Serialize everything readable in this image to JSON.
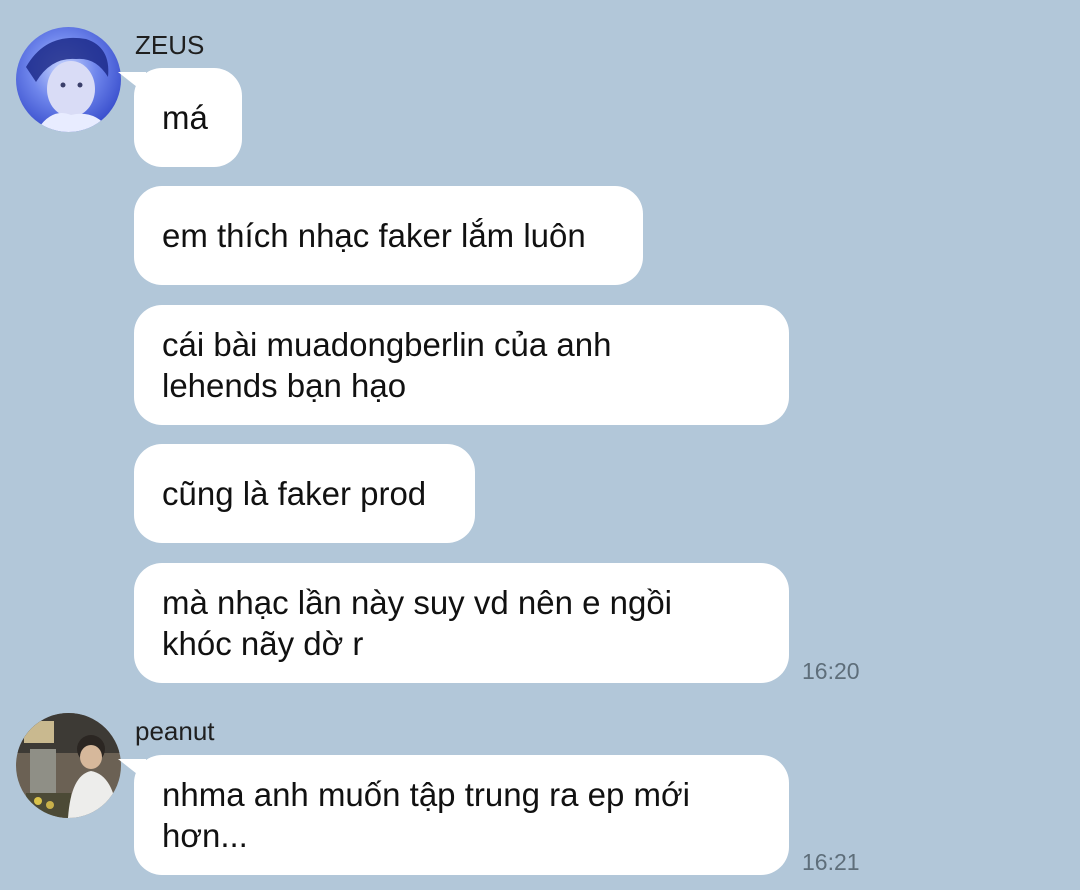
{
  "messages": [
    {
      "sender": "ZEUS",
      "avatar": "zeus-avatar",
      "bubbles": [
        {
          "text": "má"
        },
        {
          "text": "em thích nhạc faker lắm luôn"
        },
        {
          "lines": [
            "cái bài muadongberlin của anh",
            "lehends bạn hạo"
          ]
        },
        {
          "text": "cũng là faker prod"
        },
        {
          "lines": [
            "mà nhạc lần này suy vd nên e ngồi",
            "khóc nãy dờ r"
          ]
        }
      ],
      "time": "16:20"
    },
    {
      "sender": "peanut",
      "avatar": "peanut-avatar",
      "bubbles": [
        {
          "lines": [
            "nhma anh muốn tập trung ra ep mới",
            "hơn..."
          ]
        }
      ],
      "time": "16:21"
    }
  ],
  "colors": {
    "background": "#b2c7d9",
    "bubble": "#ffffff",
    "timestamp": "#5e6e7a"
  }
}
